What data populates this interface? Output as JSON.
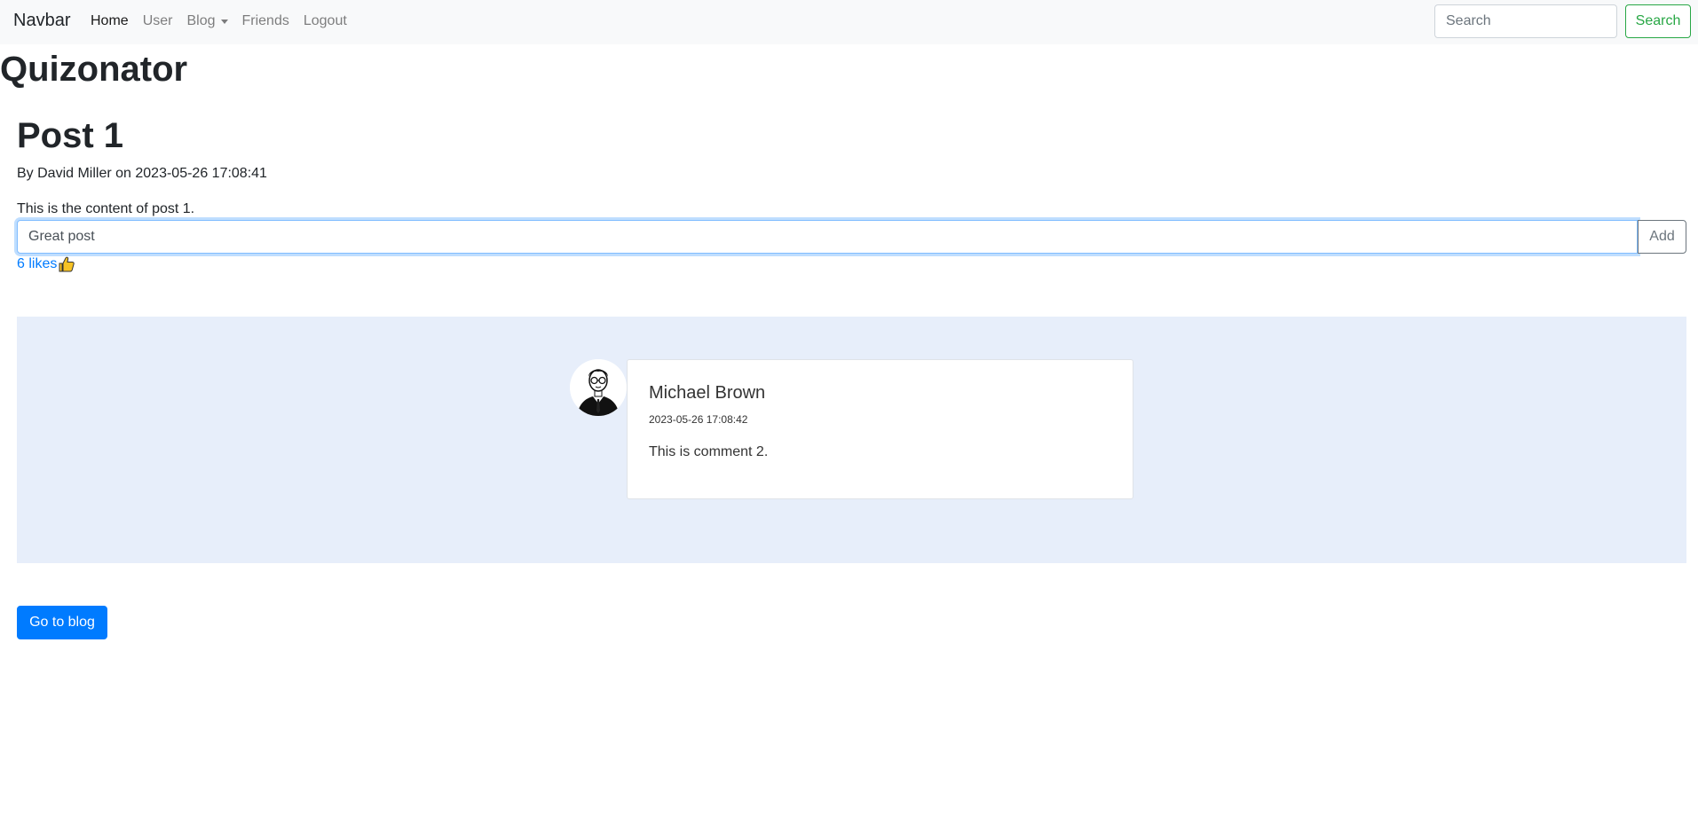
{
  "navbar": {
    "brand": "Navbar",
    "links": [
      {
        "label": "Home"
      },
      {
        "label": "User"
      },
      {
        "label": "Blog"
      },
      {
        "label": "Friends"
      },
      {
        "label": "Logout"
      }
    ],
    "search_placeholder": "Search",
    "search_button": "Search"
  },
  "app": {
    "title": "Quizonator"
  },
  "post": {
    "title": "Post 1",
    "meta": "By David Miller on 2023-05-26 17:08:41",
    "content": "This is the content of post 1.",
    "comment_input_value": "Great post",
    "add_button": "Add",
    "likes": "6 likes"
  },
  "comments": [
    {
      "author": "Michael Brown",
      "date": "2023-05-26 17:08:42",
      "text": "This is comment 2.",
      "avatar_icon": "user-avatar-icon"
    }
  ],
  "footer": {
    "go_to_blog": "Go to blog"
  },
  "colors": {
    "primary": "#007bff",
    "success": "#28a745",
    "secondary": "#6c757d",
    "comments_bg": "#e7eefa",
    "navbar_bg": "#f8f9fa"
  }
}
